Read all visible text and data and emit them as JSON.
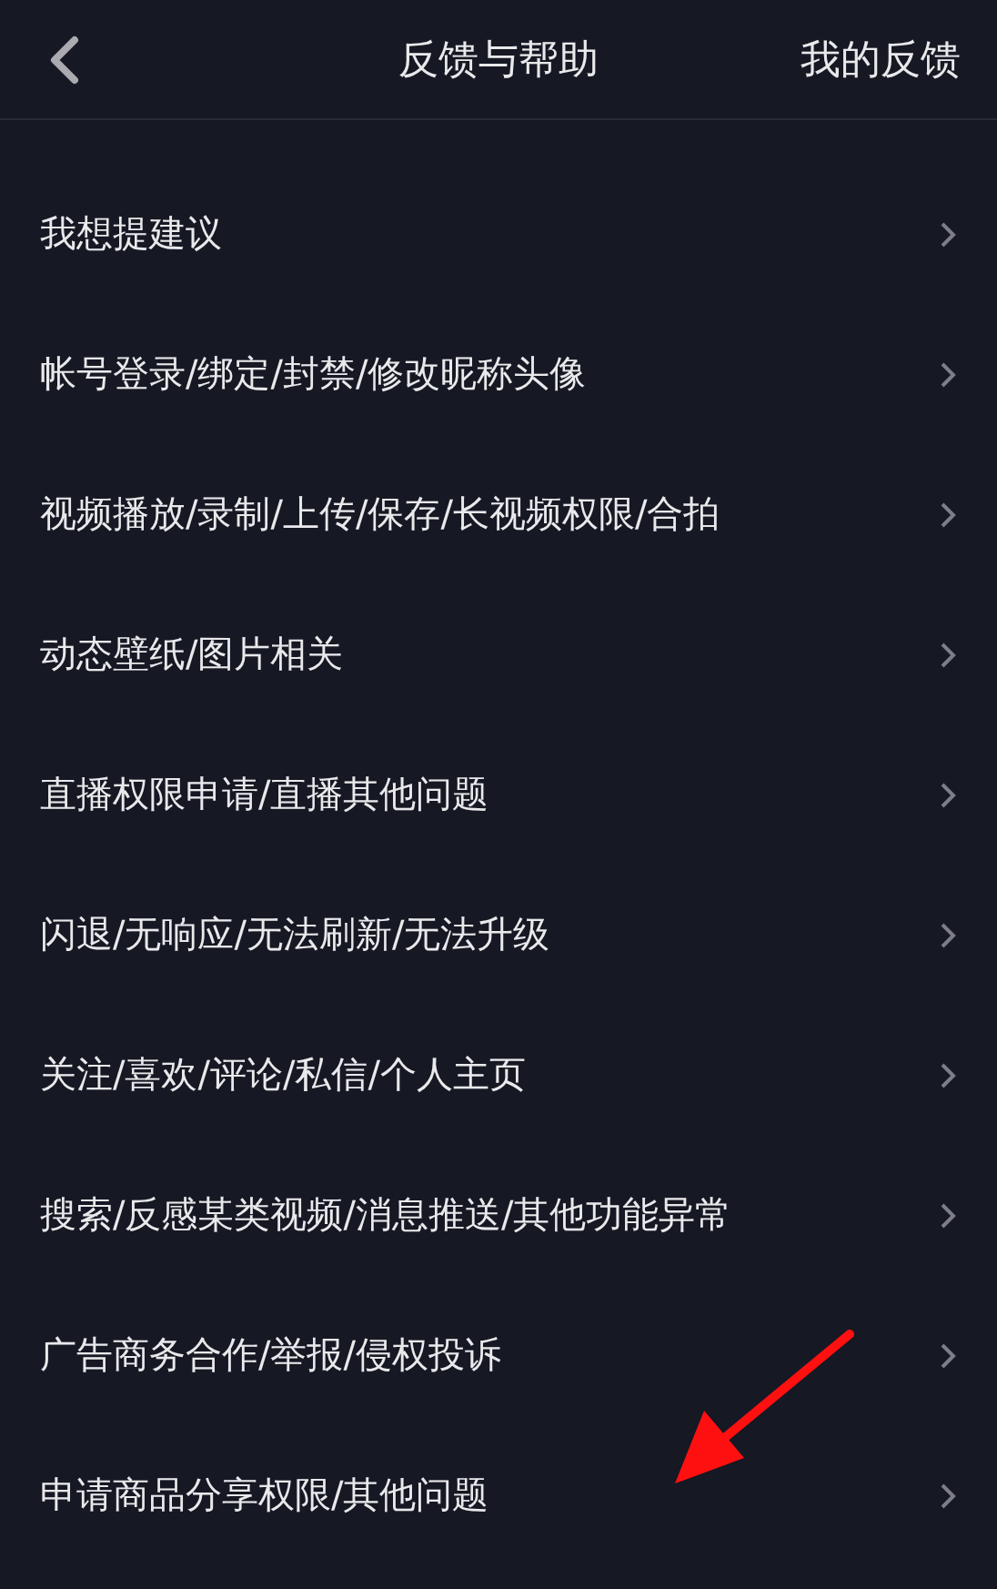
{
  "header": {
    "title": "反馈与帮助",
    "action": "我的反馈"
  },
  "items": [
    {
      "label": "我想提建议"
    },
    {
      "label": "帐号登录/绑定/封禁/修改昵称头像"
    },
    {
      "label": "视频播放/录制/上传/保存/长视频权限/合拍"
    },
    {
      "label": "动态壁纸/图片相关"
    },
    {
      "label": "直播权限申请/直播其他问题"
    },
    {
      "label": "闪退/无响应/无法刷新/无法升级"
    },
    {
      "label": "关注/喜欢/评论/私信/个人主页"
    },
    {
      "label": "搜索/反感某类视频/消息推送/其他功能异常"
    },
    {
      "label": "广告商务合作/举报/侵权投诉"
    },
    {
      "label": "申请商品分享权限/其他问题"
    }
  ]
}
